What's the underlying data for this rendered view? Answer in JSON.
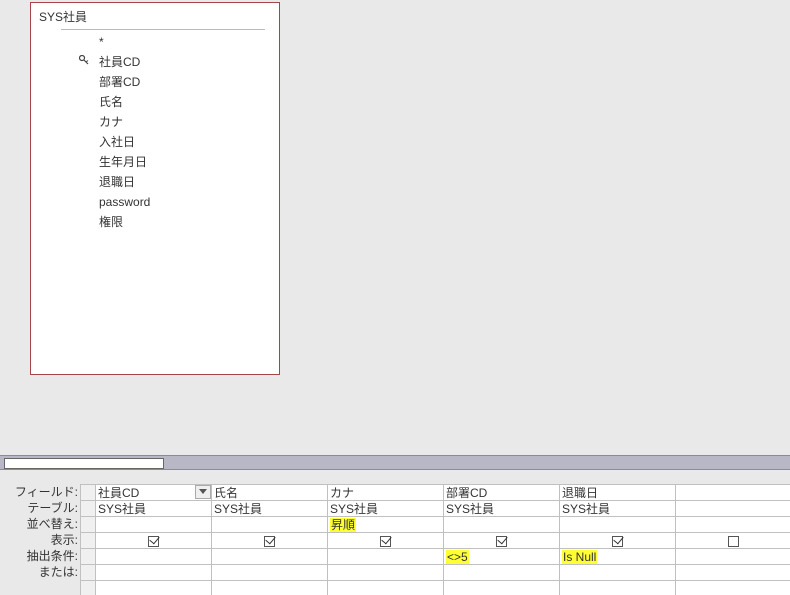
{
  "table": {
    "title": "SYS社員",
    "star": "*",
    "fields": [
      "社員CD",
      "部署CD",
      "氏名",
      "カナ",
      "入社日",
      "生年月日",
      "退職日",
      "password",
      "権限"
    ],
    "pk_index": 0
  },
  "labels": {
    "field": "フィールド:",
    "table": "テーブル:",
    "sort": "並べ替え:",
    "show": "表示:",
    "criteria": "抽出条件:",
    "or": "または:"
  },
  "columns": [
    {
      "field": "社員CD",
      "table": "SYS社員",
      "sort": "",
      "show": true,
      "criteria": "",
      "or": "",
      "active": true
    },
    {
      "field": "氏名",
      "table": "SYS社員",
      "sort": "",
      "show": true,
      "criteria": "",
      "or": ""
    },
    {
      "field": "カナ",
      "table": "SYS社員",
      "sort": "昇順",
      "sort_hl": true,
      "show": true,
      "criteria": "",
      "or": ""
    },
    {
      "field": "部署CD",
      "table": "SYS社員",
      "sort": "",
      "show": true,
      "criteria": "<>5",
      "criteria_hl": true,
      "or": ""
    },
    {
      "field": "退職日",
      "table": "SYS社員",
      "sort": "",
      "show": true,
      "criteria": "Is Null",
      "criteria_hl": true,
      "or": ""
    },
    {
      "field": "",
      "table": "",
      "sort": "",
      "show": false,
      "criteria": "",
      "or": ""
    }
  ]
}
